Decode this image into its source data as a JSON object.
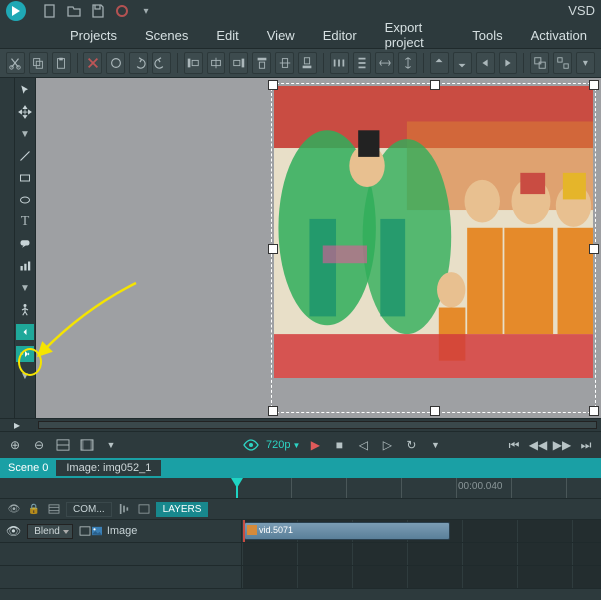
{
  "app_title": "VSD",
  "menu": [
    "Projects",
    "Scenes",
    "Edit",
    "View",
    "Editor",
    "Export project",
    "Tools",
    "Activation"
  ],
  "playback": {
    "resolution": "720p"
  },
  "scene": {
    "tab": "Scene 0",
    "image": "Image: img052_1"
  },
  "timeline": {
    "t0": "",
    "t1": "00:00.040"
  },
  "layer_tabs": {
    "com": "COM...",
    "layers": "LAYERS"
  },
  "row": {
    "blend": "Blend",
    "layer_label": "Image",
    "clip_label": "vid.5071"
  }
}
